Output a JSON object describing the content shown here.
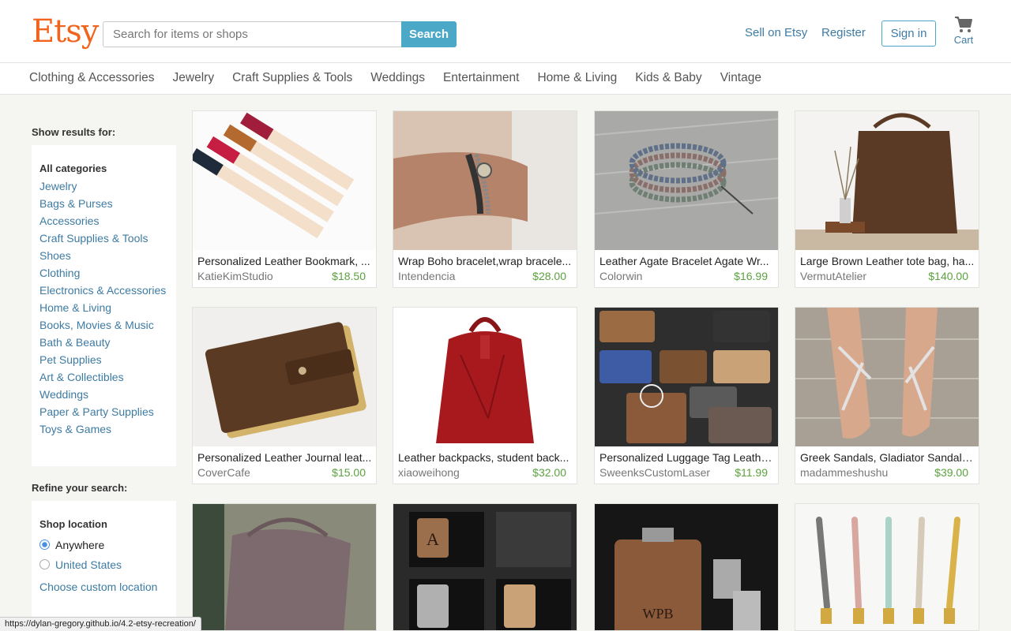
{
  "header": {
    "logo": "Etsy",
    "search_placeholder": "Search for items or shops",
    "search_button": "Search",
    "sell_link": "Sell on Etsy",
    "register_link": "Register",
    "signin_button": "Sign in",
    "cart_label": "Cart"
  },
  "nav": [
    "Clothing & Accessories",
    "Jewelry",
    "Craft Supplies & Tools",
    "Weddings",
    "Entertainment",
    "Home & Living",
    "Kids & Baby",
    "Vintage"
  ],
  "sidebar": {
    "show_results_heading": "Show results for:",
    "all_categories": "All categories",
    "categories": [
      "Jewelry",
      "Bags & Purses",
      "Accessories",
      "Craft Supplies & Tools",
      "Shoes",
      "Clothing",
      "Electronics & Accessories",
      "Home & Living",
      "Books, Movies & Music",
      "Bath & Beauty",
      "Pet Supplies",
      "Art & Collectibles",
      "Weddings",
      "Paper & Party Supplies",
      "Toys & Games"
    ],
    "refine_heading": "Refine your search:",
    "shop_location_title": "Shop location",
    "location_options": [
      {
        "label": "Anywhere",
        "selected": true
      },
      {
        "label": "United States",
        "selected": false
      }
    ],
    "custom_location_link": "Choose custom location"
  },
  "listings": [
    {
      "title": "Personalized Leather Bookmark, ...",
      "shop": "KatieKimStudio",
      "price": "$18.50",
      "image": "leather-bookmarks"
    },
    {
      "title": "Wrap Boho bracelet,wrap bracele...",
      "shop": "Intendencia",
      "price": "$28.00",
      "image": "wrap-bracelet"
    },
    {
      "title": "Leather Agate Bracelet Agate Wr...",
      "shop": "Colorwin",
      "price": "$16.99",
      "image": "agate-bracelet"
    },
    {
      "title": "Large Brown Leather tote bag, ha...",
      "shop": "VermutAtelier",
      "price": "$140.00",
      "image": "leather-tote"
    },
    {
      "title": "Personalized Leather Journal leat...",
      "shop": "CoverCafe",
      "price": "$15.00",
      "image": "leather-journal"
    },
    {
      "title": "Leather backpacks, student back...",
      "shop": "xiaoweihong",
      "price": "$32.00",
      "image": "red-backpack"
    },
    {
      "title": "Personalized Luggage Tag Leathe...",
      "shop": "SweenksCustomLaser",
      "price": "$11.99",
      "image": "luggage-tags"
    },
    {
      "title": "Greek Sandals, Gladiator Sandals...",
      "shop": "madammeshushu",
      "price": "$39.00",
      "image": "greek-sandals"
    }
  ],
  "partial_listings": [
    {
      "image": "grey-handbag"
    },
    {
      "image": "flask-gift-sets",
      "text": "A"
    },
    {
      "image": "wood-flask",
      "text": "WPB"
    },
    {
      "image": "rope-keychains"
    }
  ],
  "status_bar_url": "https://dylan-gregory.github.io/4.2-etsy-recreation/",
  "colors": {
    "brand": "#f1641e",
    "link": "#3d7ba3",
    "search_button": "#4ba9c7",
    "price": "#5ba23f"
  }
}
